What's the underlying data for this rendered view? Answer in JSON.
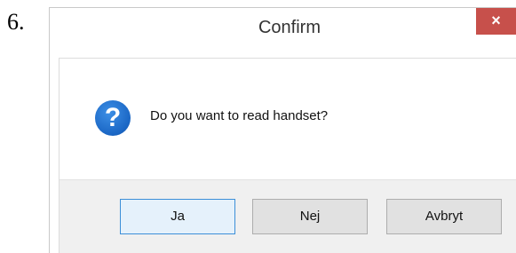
{
  "step": {
    "number": "6."
  },
  "dialog": {
    "title": "Confirm",
    "close_label": "×",
    "icon": "question-icon",
    "icon_glyph": "?",
    "message": "Do you want to read handset?",
    "buttons": {
      "yes_label": "Ja",
      "no_label": "Nej",
      "cancel_label": "Avbryt"
    }
  },
  "colors": {
    "close_button": "#c7504b",
    "default_button_border": "#3c8fd8",
    "icon": "#1a66c4",
    "button_bar": "#f0f0f0"
  }
}
